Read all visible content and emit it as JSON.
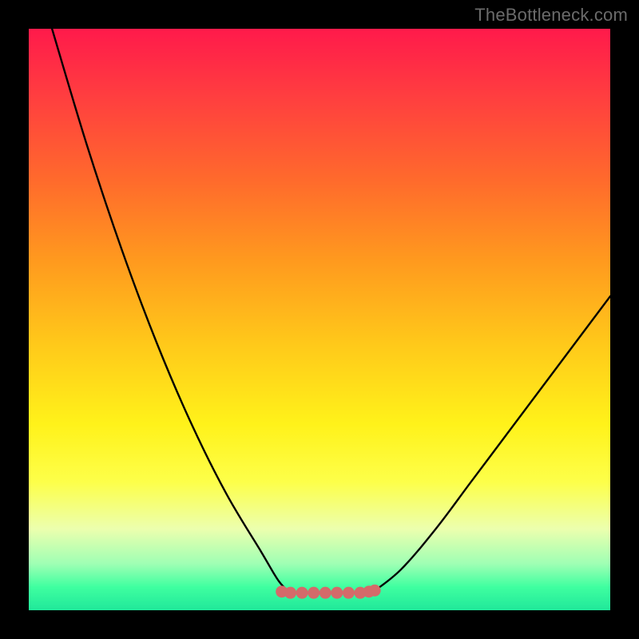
{
  "watermark": "TheBottleneck.com",
  "chart_data": {
    "type": "line",
    "title": "",
    "xlabel": "",
    "ylabel": "",
    "xlim": [
      0,
      100
    ],
    "ylim": [
      0,
      100
    ],
    "series": [
      {
        "name": "left-curve",
        "x": [
          4,
          10,
          16,
          22,
          28,
          34,
          40,
          43,
          45
        ],
        "values": [
          100,
          80,
          62,
          46,
          32,
          20,
          10,
          5,
          3
        ]
      },
      {
        "name": "flat-segment",
        "x": [
          45,
          48,
          52,
          56,
          59
        ],
        "values": [
          3,
          3,
          3,
          3,
          3
        ]
      },
      {
        "name": "right-curve",
        "x": [
          59,
          64,
          70,
          76,
          82,
          88,
          94,
          100
        ],
        "values": [
          3,
          7,
          14,
          22,
          30,
          38,
          46,
          54
        ]
      },
      {
        "name": "bottom-dots",
        "x": [
          43.5,
          45,
          47,
          49,
          51,
          53,
          55,
          57,
          58.5,
          59.5
        ],
        "values": [
          3.2,
          3.0,
          3.0,
          3.0,
          3.0,
          3.0,
          3.0,
          3.0,
          3.2,
          3.4
        ]
      }
    ],
    "colors": {
      "curve": "#000000",
      "dots": "#d46a6a"
    }
  }
}
